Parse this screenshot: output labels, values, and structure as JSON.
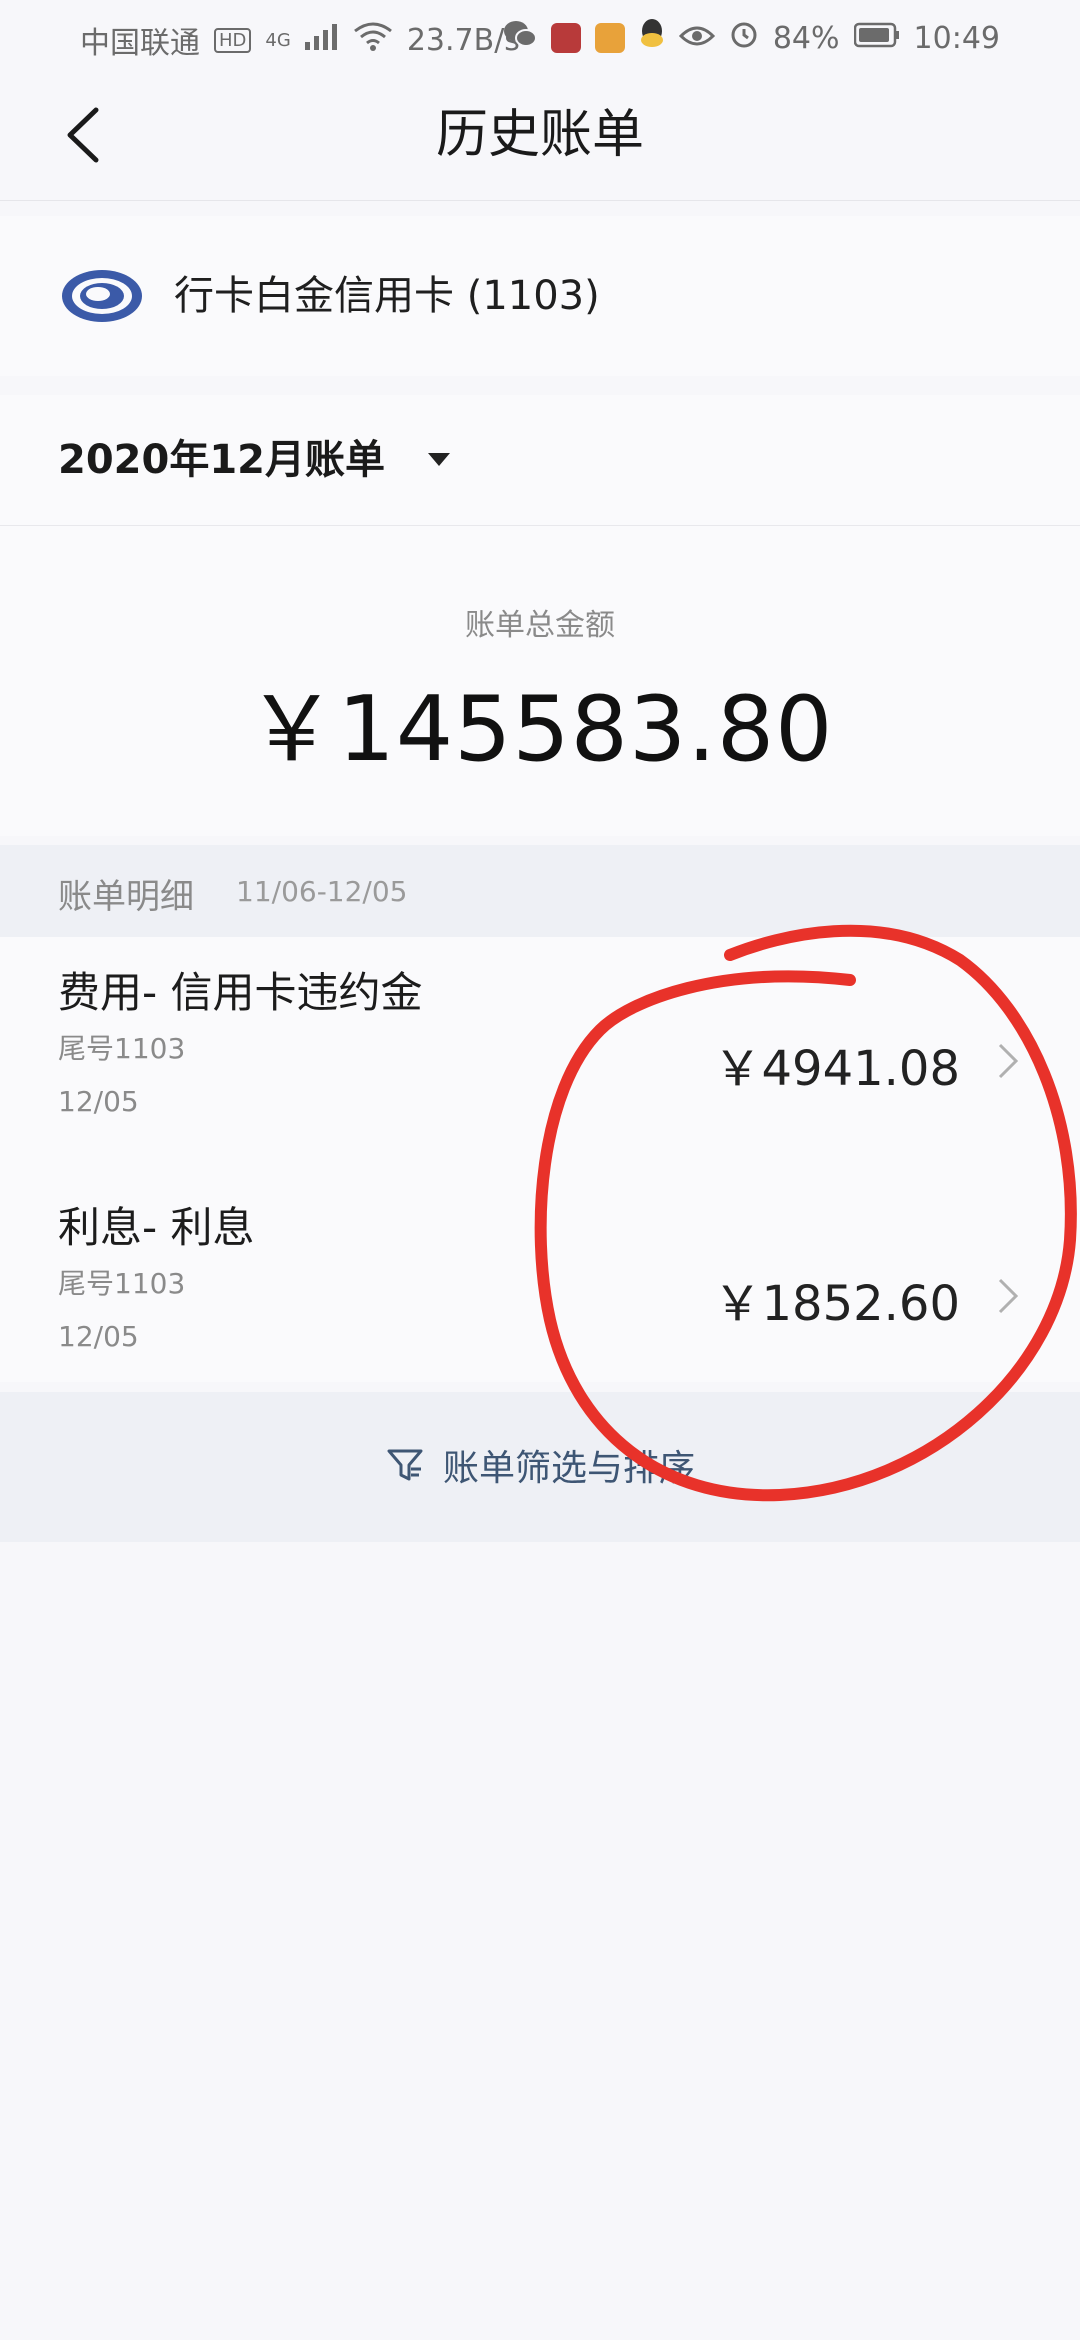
{
  "status_bar": {
    "carrier": "中国联通",
    "hd": "HD",
    "network": "4G",
    "speed": "23.7B/s",
    "battery": "84%",
    "time": "10:49"
  },
  "header": {
    "title": "历史账单"
  },
  "card": {
    "name": "行卡白金信用卡 (1103)"
  },
  "bill_period": {
    "label": "2020年12月账单"
  },
  "total": {
    "caption": "账单总金额",
    "amount": "￥145583.80"
  },
  "details": {
    "title": "账单明细",
    "range": "11/06-12/05",
    "items": [
      {
        "title": "费用- 信用卡违约金",
        "tail": "尾号1103",
        "date": "12/05",
        "amount": "￥4941.08"
      },
      {
        "title": "利息- 利息",
        "tail": "尾号1103",
        "date": "12/05",
        "amount": "￥1852.60"
      }
    ]
  },
  "footer": {
    "filter_label": "账单筛选与排序"
  },
  "colors": {
    "annotation": "#e8322a",
    "accent": "#3e5674",
    "background": "#f7f7fa"
  }
}
